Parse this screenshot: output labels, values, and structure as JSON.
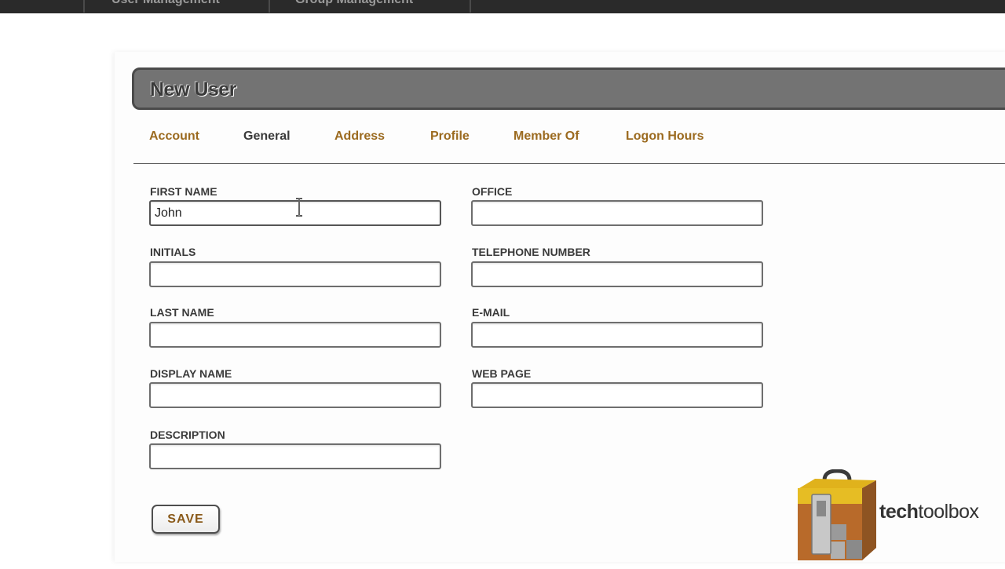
{
  "top_nav": {
    "tabs": [
      {
        "label": "User Management"
      },
      {
        "label": "Group Management"
      }
    ]
  },
  "header": {
    "title": "New User"
  },
  "tabs": [
    {
      "label": "Account",
      "active": false
    },
    {
      "label": "General",
      "active": true
    },
    {
      "label": "Address",
      "active": false
    },
    {
      "label": "Profile",
      "active": false
    },
    {
      "label": "Member Of",
      "active": false
    },
    {
      "label": "Logon Hours",
      "active": false
    }
  ],
  "form": {
    "first_name": {
      "label": "FIRST NAME",
      "value": "John"
    },
    "initials": {
      "label": "INITIALS",
      "value": ""
    },
    "last_name": {
      "label": "LAST NAME",
      "value": ""
    },
    "display_name": {
      "label": "DISPLAY NAME",
      "value": ""
    },
    "description": {
      "label": "DESCRIPTION",
      "value": ""
    },
    "office": {
      "label": "OFFICE",
      "value": ""
    },
    "telephone": {
      "label": "TELEPHONE NUMBER",
      "value": ""
    },
    "email": {
      "label": "E-MAIL",
      "value": ""
    },
    "web_page": {
      "label": "WEB PAGE",
      "value": ""
    }
  },
  "actions": {
    "save_label": "SAVE"
  },
  "logo": {
    "tech": "tech",
    "toolbox": "toolbox"
  },
  "colors": {
    "tab_link": "#9b6a1f",
    "tab_active": "#3a3a3a",
    "header_bg": "#737373",
    "topbar_bg": "#2a2a2a"
  }
}
